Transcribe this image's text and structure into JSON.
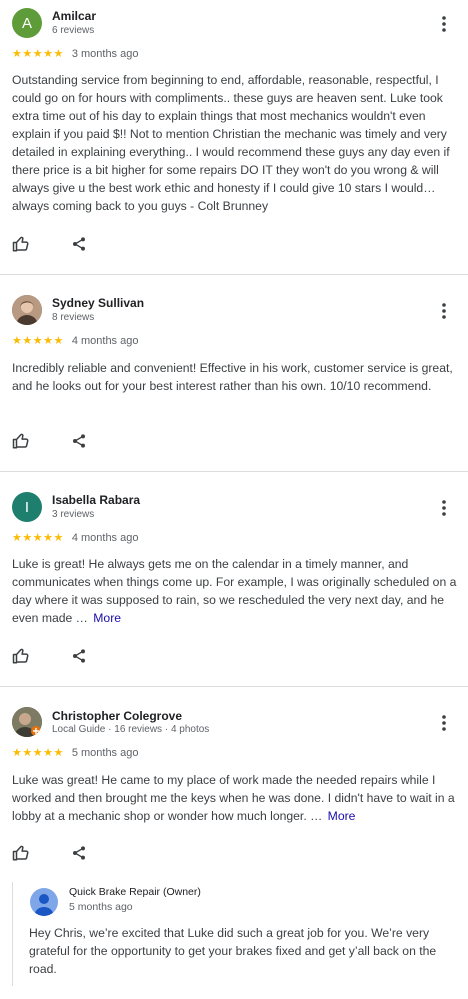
{
  "reviews": [
    {
      "avatar_letter": "A",
      "avatar_color": "#5e9c3a",
      "name": "Amilcar",
      "meta": "6 reviews",
      "stars": "★★★★★",
      "date": "3 months ago",
      "text": "Outstanding service from beginning to end, affordable, reasonable, respectful, I could go on for hours with compliments.. these guys are heaven sent. Luke took extra time out of his day to explain things that most mechanics wouldn't even explain if you paid $!! Not to mention Christian the mechanic was timely and very detailed in explaining everything.. I would recommend these guys any day even if there price is a bit higher for some repairs DO IT they won't do you wrong & will always give u the best work ethic and honesty if I could give 10 stars I would… always coming back to you guys - Colt Brunney"
    },
    {
      "avatar_letter": "",
      "avatar_color": "#8a6b58",
      "name": "Sydney Sullivan",
      "meta": "8 reviews",
      "stars": "★★★★★",
      "date": "4 months ago",
      "text": "Incredibly reliable and convenient! Effective in his work, customer service is great, and he looks out for your best interest rather than his own. 10/10 recommend."
    },
    {
      "avatar_letter": "I",
      "avatar_color": "#1e7f6e",
      "name": "Isabella Rabara",
      "meta": "3 reviews",
      "stars": "★★★★★",
      "date": "4 months ago",
      "text": "Luke is great! He always gets me on the calendar in a timely manner, and communicates when things come up. For example, I was originally scheduled on a day where it was supposed to rain, so we rescheduled the very next day, and he even made …",
      "more": "More"
    },
    {
      "avatar_letter": "",
      "avatar_color": "#6b6a55",
      "name": "Christopher Colegrove",
      "meta": "Local Guide · 16 reviews · 4 photos",
      "stars": "★★★★★",
      "date": "5 months ago",
      "text": "Luke was great! He came to my place of work made the needed repairs while I worked and then brought me the keys when he was done. I didn't have to wait in a lobby at a mechanic shop or wonder how much longer. …",
      "more": "More"
    }
  ],
  "owner_reply": {
    "name": "Quick Brake Repair (Owner)",
    "date": "5 months ago",
    "text": "Hey Chris, we’re excited that Luke did such a great job for you. We’re very grateful for the opportunity to get your brakes fixed and get y’all back on the road."
  },
  "icons": {
    "like": "thumbs-up-icon",
    "share": "share-icon",
    "menu": "more-vert-icon"
  }
}
